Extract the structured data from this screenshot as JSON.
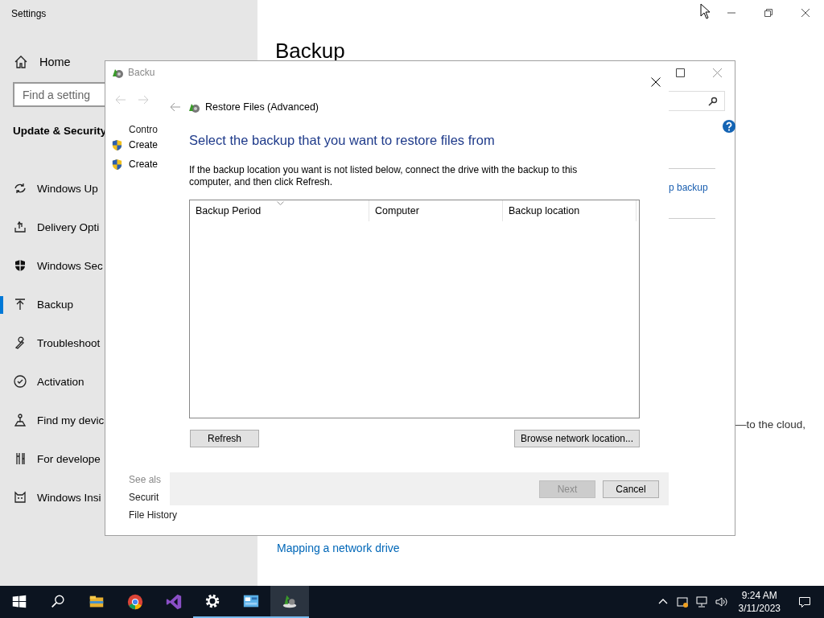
{
  "settings_window": {
    "title": "Settings",
    "sidebar": {
      "home": "Home",
      "search": {
        "placeholder": "Find a setting"
      },
      "section_title": "Update & Security",
      "items": [
        {
          "label": "Windows Up",
          "selected": false
        },
        {
          "label": "Delivery Opti",
          "selected": false
        },
        {
          "label": "Windows Sec",
          "selected": false
        },
        {
          "label": "Backup",
          "selected": true
        },
        {
          "label": "Troubleshoot",
          "selected": false
        },
        {
          "label": "Activation",
          "selected": false
        },
        {
          "label": "Find my devic",
          "selected": false
        },
        {
          "label": "For develope",
          "selected": false
        },
        {
          "label": "Windows Insi",
          "selected": false
        }
      ]
    },
    "main": {
      "heading": "Backup",
      "text_fragment": "—to the cloud,",
      "link": "Mapping a network drive"
    }
  },
  "backup_window": {
    "title": "Backu",
    "left_pane": {
      "top_link": "Contro",
      "tasks": [
        "Create",
        "Create"
      ],
      "see_also_title": "See als",
      "see_also": [
        "Securit",
        "File History"
      ]
    },
    "right_pane": {
      "link": "p backup"
    }
  },
  "wizard": {
    "title": "Restore Files (Advanced)",
    "heading": "Select the backup that you want to restore files from",
    "instruction": "If the backup location you want is not listed below, connect the drive with the backup to this computer, and then click Refresh.",
    "columns": [
      "Backup Period",
      "Computer",
      "Backup location"
    ],
    "buttons": [
      {
        "label": "Refresh",
        "disabled": false
      },
      {
        "label": "Browse network location...",
        "disabled": false
      }
    ],
    "footer_buttons": [
      {
        "label": "Next",
        "disabled": true
      },
      {
        "label": "Cancel",
        "disabled": false
      }
    ]
  },
  "taskbar": {
    "apps": [
      {
        "kind": "explorer",
        "running": false,
        "selected": false
      },
      {
        "kind": "chrome",
        "running": false,
        "selected": false
      },
      {
        "kind": "studio",
        "running": false,
        "selected": false
      },
      {
        "kind": "settings",
        "running": true,
        "selected": false
      },
      {
        "kind": "panel",
        "running": true,
        "selected": false
      },
      {
        "kind": "backup",
        "running": true,
        "selected": true
      }
    ],
    "time": "9:24 AM",
    "date": "3/11/2023"
  }
}
